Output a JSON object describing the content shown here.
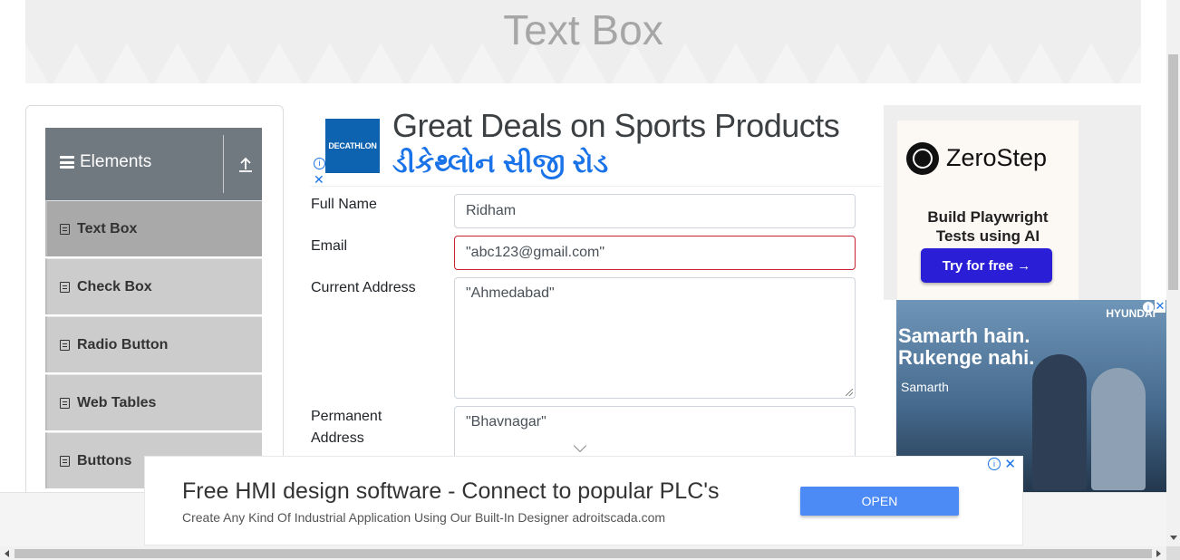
{
  "page": {
    "title": "Text Box"
  },
  "sidebar": {
    "group_title": "Elements",
    "items": [
      {
        "label": "Text Box",
        "active": true
      },
      {
        "label": "Check Box"
      },
      {
        "label": "Radio Button"
      },
      {
        "label": "Web Tables"
      },
      {
        "label": "Buttons"
      }
    ]
  },
  "ads": {
    "top_banner": {
      "brand": "DECATHLON",
      "headline": "Great Deals on Sports Products",
      "subline": "ડીકેથ્લોન સીજી રોડ"
    },
    "zerostep": {
      "name": "ZeroStep",
      "tagline": "Build Playwright\nTests using AI",
      "cta": "Try for free →"
    },
    "hyundai": {
      "brand": "HYUNDAI",
      "headline": "Samarth hain.\nRukenge nahi.",
      "logo_text": "Samarth"
    },
    "bottom": {
      "title": "Free HMI design software - Connect to popular PLC's",
      "subtitle": "Create Any Kind Of Industrial Application Using Our Built-In Designer adroitscada.com",
      "cta": "OPEN"
    }
  },
  "form": {
    "full_name": {
      "label": "Full Name",
      "value": "Ridham"
    },
    "email": {
      "label": "Email",
      "value": "\"abc123@gmail.com\"",
      "error": true
    },
    "current_address": {
      "label": "Current Address",
      "value": "\"Ahmedabad\""
    },
    "permanent_address": {
      "label": "Permanent Address",
      "value": "\"Bhavnagar\""
    }
  },
  "colors": {
    "sidebar_header": "#707880",
    "menu_item": "#cccccc",
    "menu_active": "#a9a9a9",
    "error_border": "#c82333",
    "zerostep_button": "#2a1fd6",
    "open_button": "#4c8bf5"
  }
}
